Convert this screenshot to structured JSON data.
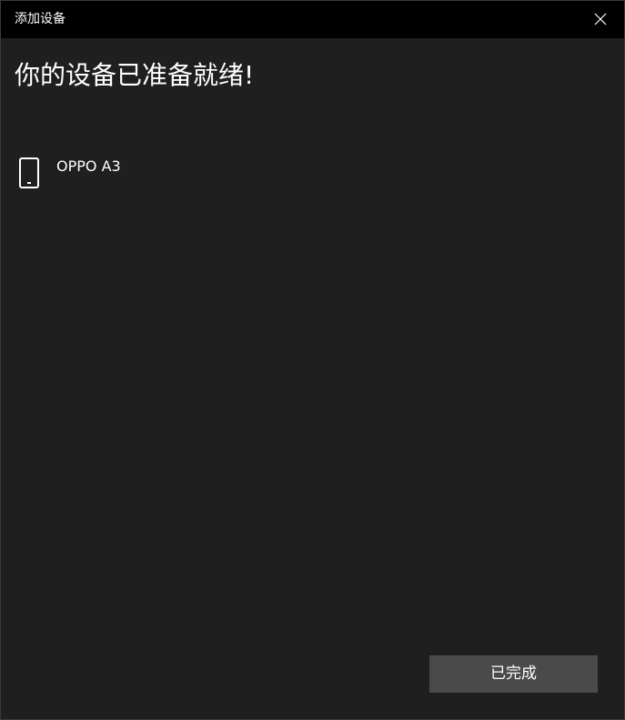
{
  "window": {
    "title": "添加设备"
  },
  "main": {
    "heading": "你的设备已准备就绪!",
    "device": {
      "name": "OPPO A3",
      "icon": "smartphone-icon"
    }
  },
  "footer": {
    "done_label": "已完成"
  },
  "colors": {
    "titlebar": "#000000",
    "background": "#1f1f1f",
    "button": "#4a4a4a",
    "text": "#ffffff"
  }
}
